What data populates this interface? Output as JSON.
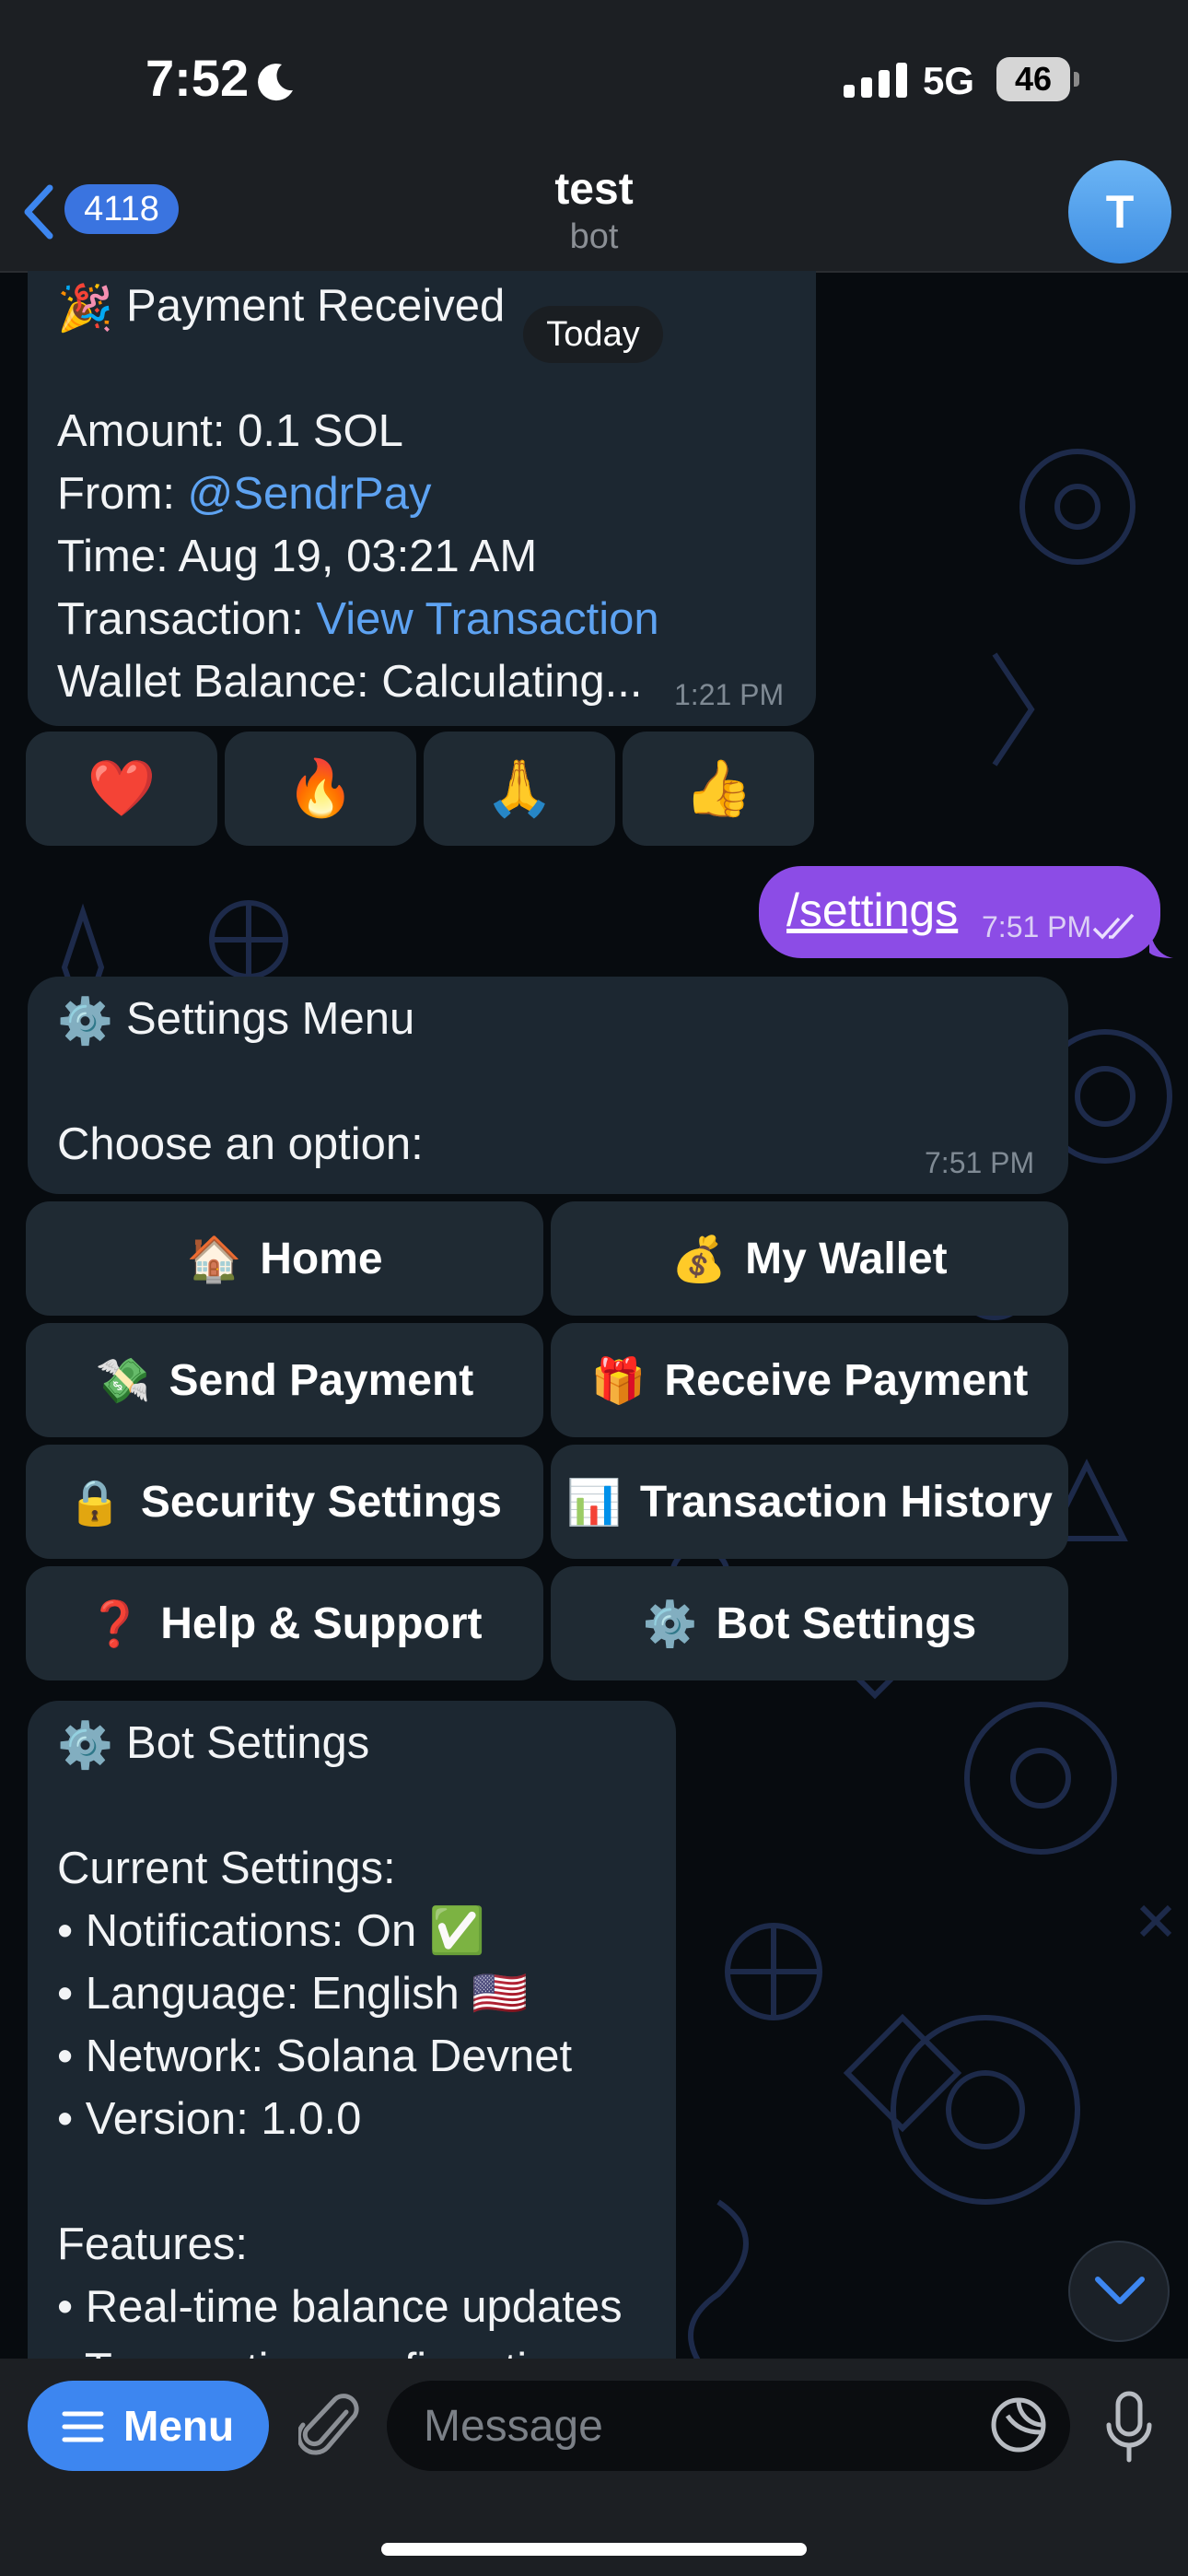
{
  "status_bar": {
    "time": "7:52",
    "network": "5G",
    "battery": "46"
  },
  "header": {
    "back_count": "4118",
    "title": "test",
    "subtitle": "bot",
    "avatar_letter": "T"
  },
  "date_pill": "Today",
  "payment_message": {
    "emoji": "🎉",
    "title": "Payment Received",
    "amount": "Amount: 0.1 SOL",
    "from_label": "From: ",
    "from_link": "@SendrPay",
    "time_line": "Time: Aug 19, 03:21 AM",
    "transaction_label": "Transaction: ",
    "transaction_link": "View Transaction",
    "wallet_balance": "Wallet Balance: Calculating...",
    "timestamp": "1:21 PM"
  },
  "reactions": [
    "❤️",
    "🔥",
    "🙏",
    "👍"
  ],
  "outgoing_message": {
    "text": "/settings",
    "timestamp": "7:51 PM"
  },
  "settings_message": {
    "emoji": "⚙️",
    "title": "Settings Menu",
    "prompt": "Choose an option:",
    "timestamp": "7:51 PM"
  },
  "keyboard": [
    {
      "icon": "🏠",
      "label": "Home"
    },
    {
      "icon": "💰",
      "label": "My Wallet"
    },
    {
      "icon": "💸",
      "label": "Send Payment"
    },
    {
      "icon": "🎁",
      "label": "Receive Payment"
    },
    {
      "icon": "🔒",
      "label": "Security Settings"
    },
    {
      "icon": "📊",
      "label": "Transaction History"
    },
    {
      "icon": "❓",
      "label": "Help & Support"
    },
    {
      "icon": "⚙️",
      "label": "Bot Settings"
    }
  ],
  "bot_settings_message": {
    "emoji": "⚙️",
    "title": "Bot Settings",
    "current_header": "Current Settings:",
    "notifications": "• Notifications: On ✅",
    "language": "• Language: English 🇺🇸",
    "network": "• Network: Solana Devnet",
    "version": "• Version: 1.0.0",
    "features_header": "Features:",
    "feature_1": "• Real-time balance updates",
    "feature_2": "• Transaction confirmations"
  },
  "input_bar": {
    "menu_label": "Menu",
    "placeholder": "Message"
  },
  "colors": {
    "accent_blue": "#3d86f0",
    "outgoing_bubble": "#8c4ce6",
    "link": "#5ea3f2",
    "bubble": "#1c2731"
  }
}
